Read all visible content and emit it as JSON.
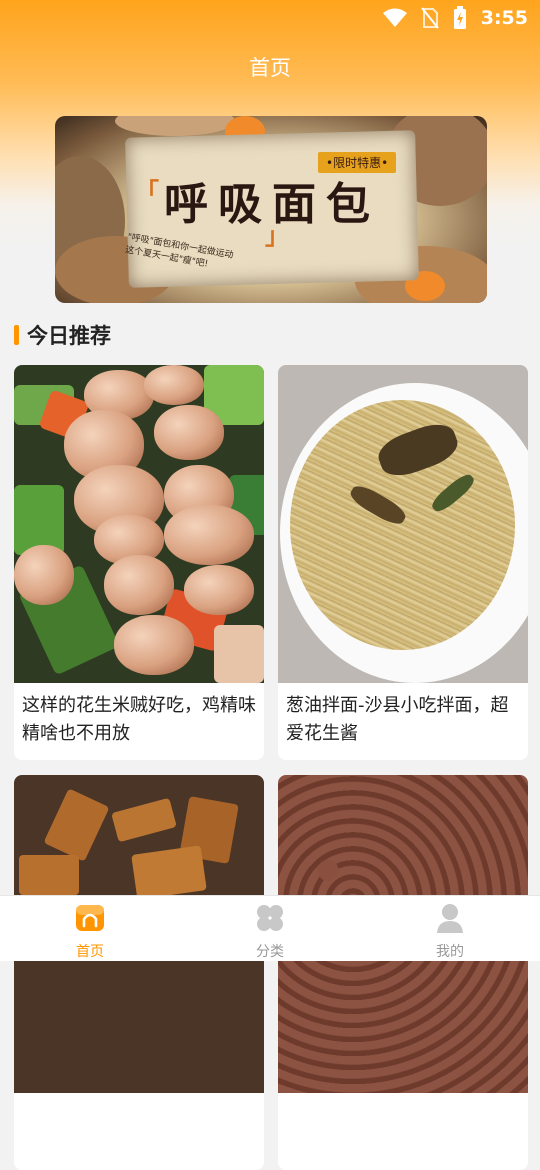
{
  "status_bar": {
    "time": "3:55"
  },
  "header": {
    "title": "首页"
  },
  "banner": {
    "title": "呼吸面包",
    "tag": "•限时特惠•",
    "subtitle_line1": "\"呼吸\"面包和你一起做运动",
    "subtitle_line2": "这个夏天一起\"瘦\"吧!"
  },
  "section": {
    "title": "今日推荐"
  },
  "recipes": [
    {
      "title": "这样的花生米贼好吃，鸡精味精啥也不用放"
    },
    {
      "title": "葱油拌面-沙县小吃拌面，超爱花生酱"
    },
    {
      "title": ""
    },
    {
      "title": ""
    }
  ],
  "tabbar": {
    "items": [
      {
        "label": "首页",
        "icon": "home-icon",
        "active": true
      },
      {
        "label": "分类",
        "icon": "category-icon",
        "active": false
      },
      {
        "label": "我的",
        "icon": "profile-icon",
        "active": false
      }
    ]
  },
  "colors": {
    "accent": "#ff9500",
    "header_gradient": "#ffa41c"
  }
}
